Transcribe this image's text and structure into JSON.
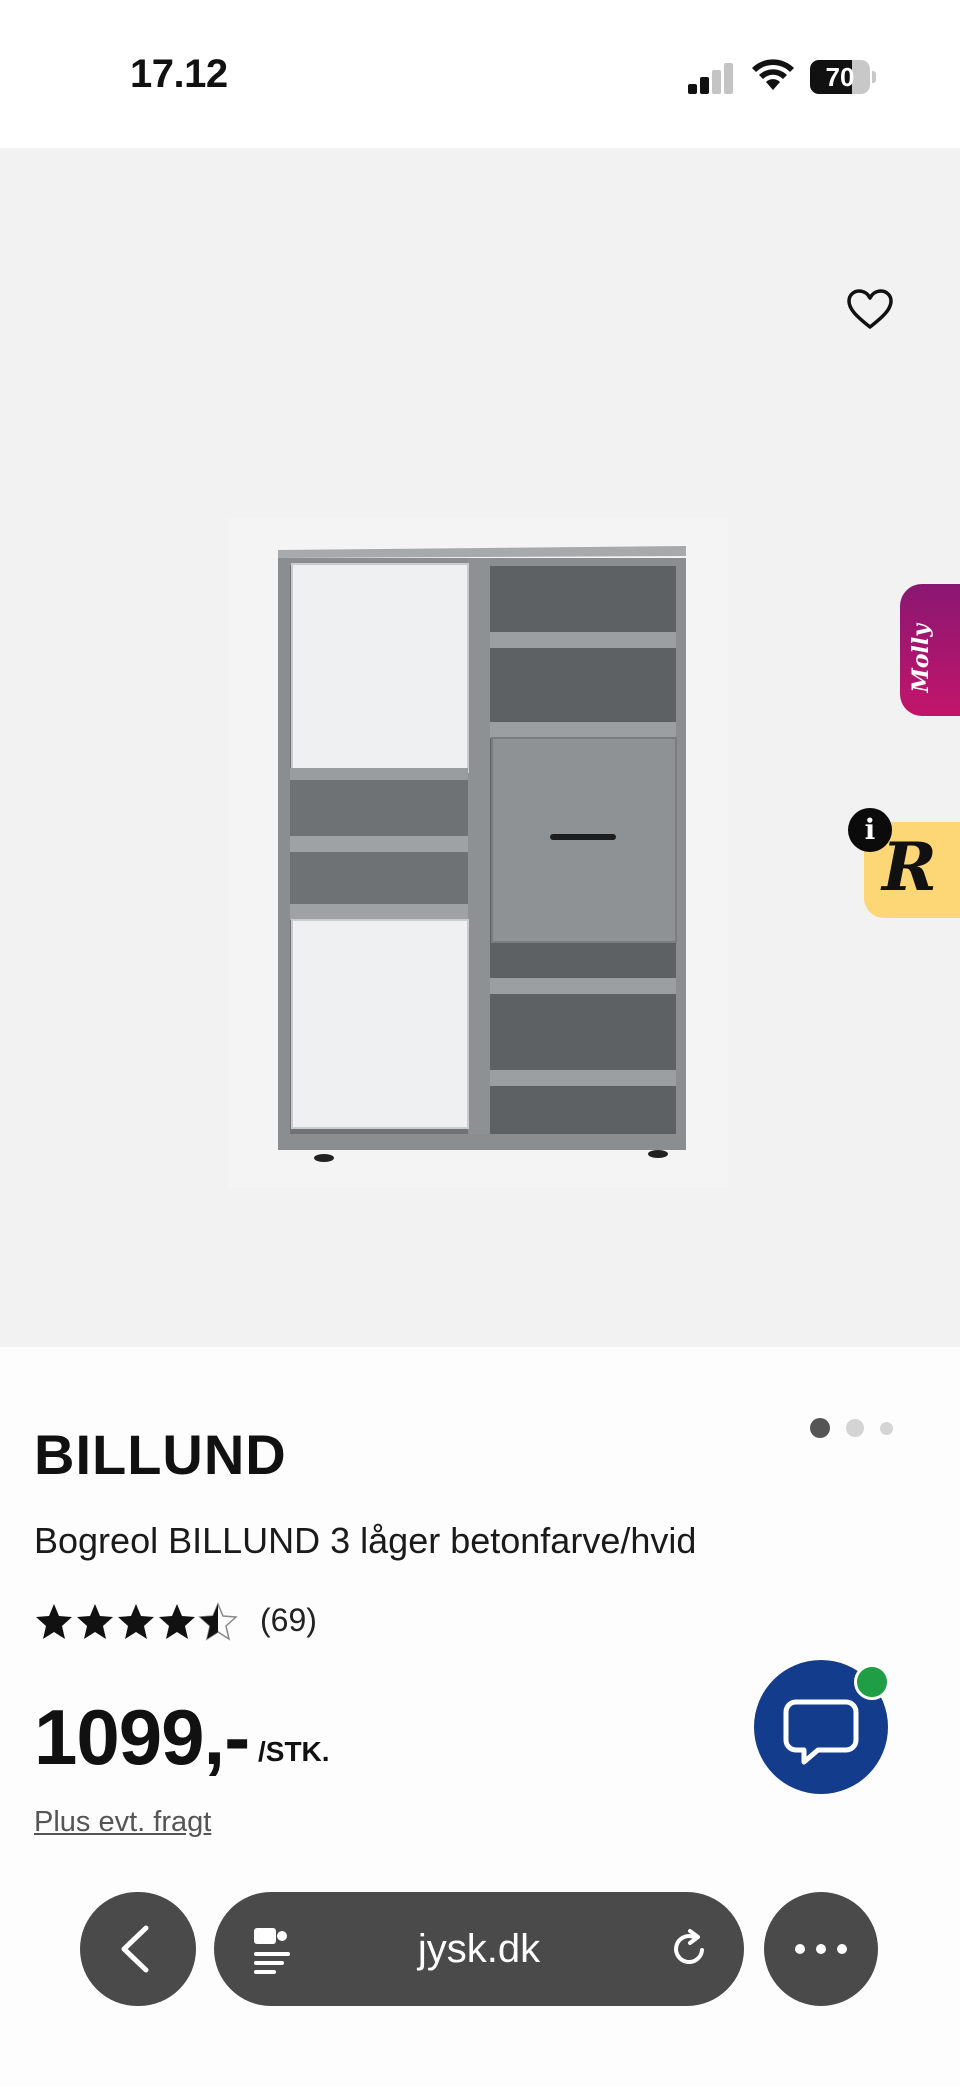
{
  "status_bar": {
    "time": "17.12",
    "battery_level": "70"
  },
  "gallery": {
    "image_count": 3,
    "active_index": 0,
    "molly_label": "Molly",
    "r_widget_letter": "R",
    "info_badge": "i"
  },
  "product": {
    "brand": "BILLUND",
    "name": "Bogreol BILLUND 3 låger betonfarve/hvid",
    "rating": 4.5,
    "review_count": "(69)",
    "price": "1099,-",
    "unit": "/STK.",
    "freight_link": "Plus evt. fragt"
  },
  "browser": {
    "url": "jysk.dk"
  },
  "colors": {
    "chat_button": "#143c8c",
    "online_dot": "#1f9e45",
    "molly_gradient_top": "#8a1772",
    "r_widget": "#fdd775",
    "toolbar_pill": "#4a4a4a"
  }
}
